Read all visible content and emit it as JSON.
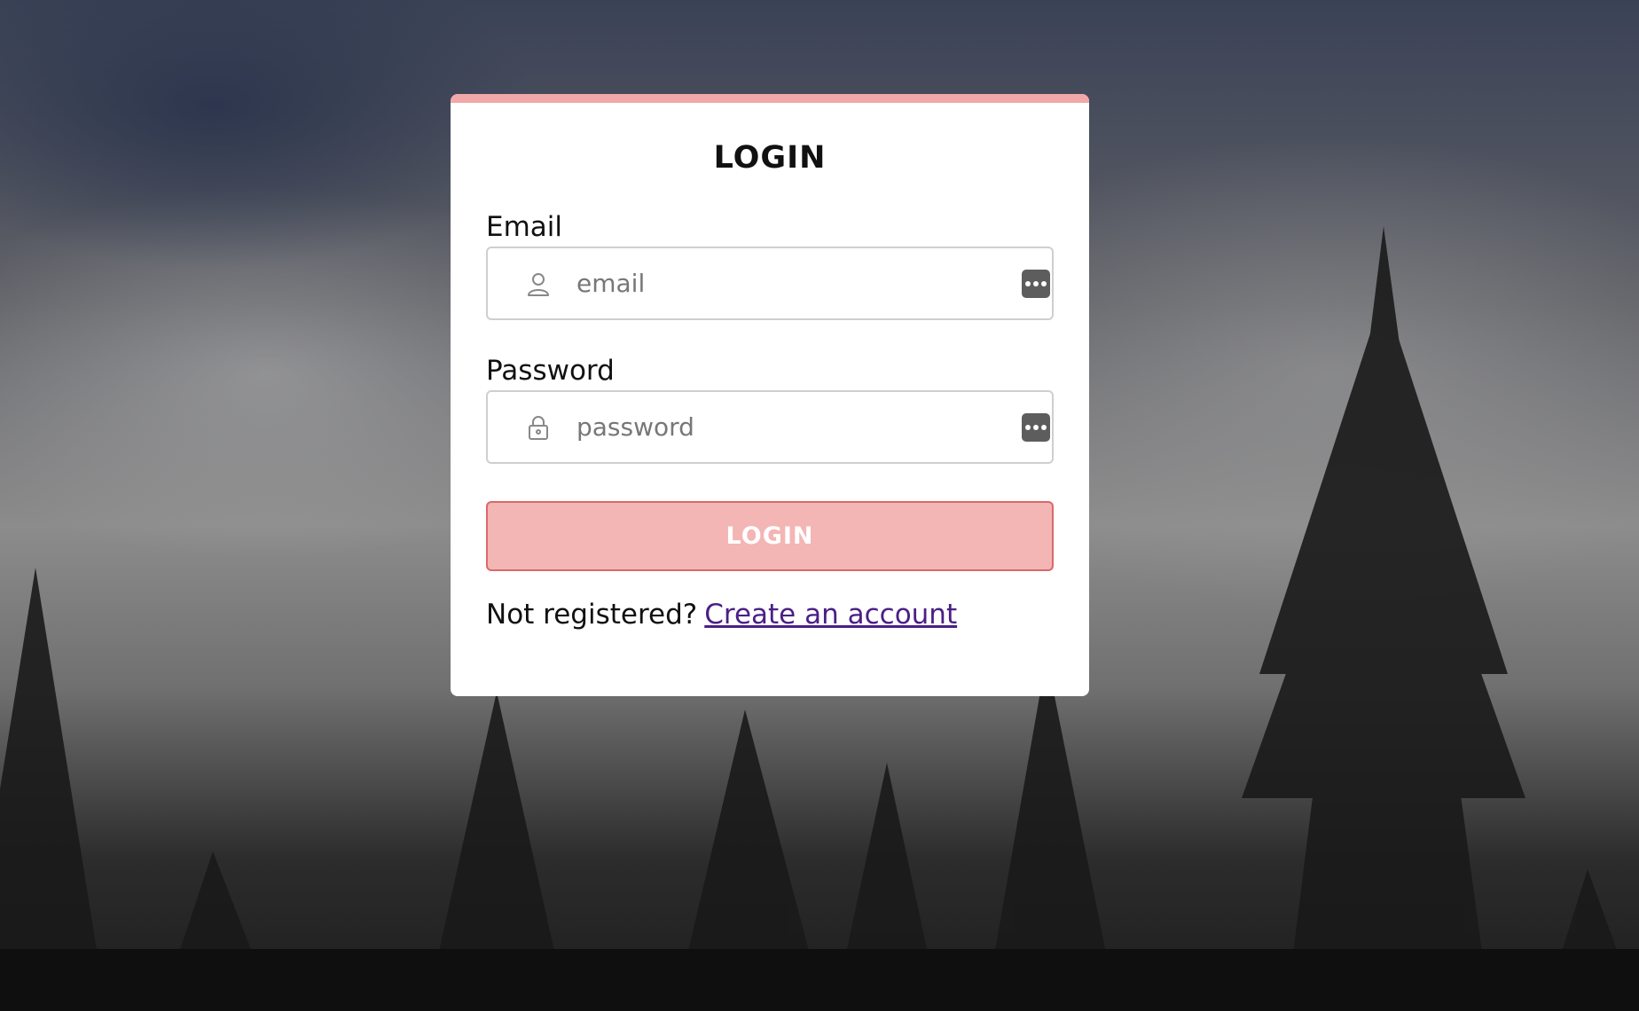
{
  "login_card": {
    "title": "LOGIN",
    "accent_color": "#f2a8a8",
    "email": {
      "label": "Email",
      "placeholder": "email",
      "value": "",
      "icon": "user-icon",
      "trailing_icon": "password-manager-icon"
    },
    "password": {
      "label": "Password",
      "placeholder": "password",
      "value": "",
      "icon": "lock-icon",
      "trailing_icon": "password-manager-icon"
    },
    "submit_label": "LOGIN",
    "submit_color": "#f4b5b5",
    "register_prompt": "Not registered?",
    "register_link": "Create an account",
    "link_color": "#4b1f86"
  }
}
